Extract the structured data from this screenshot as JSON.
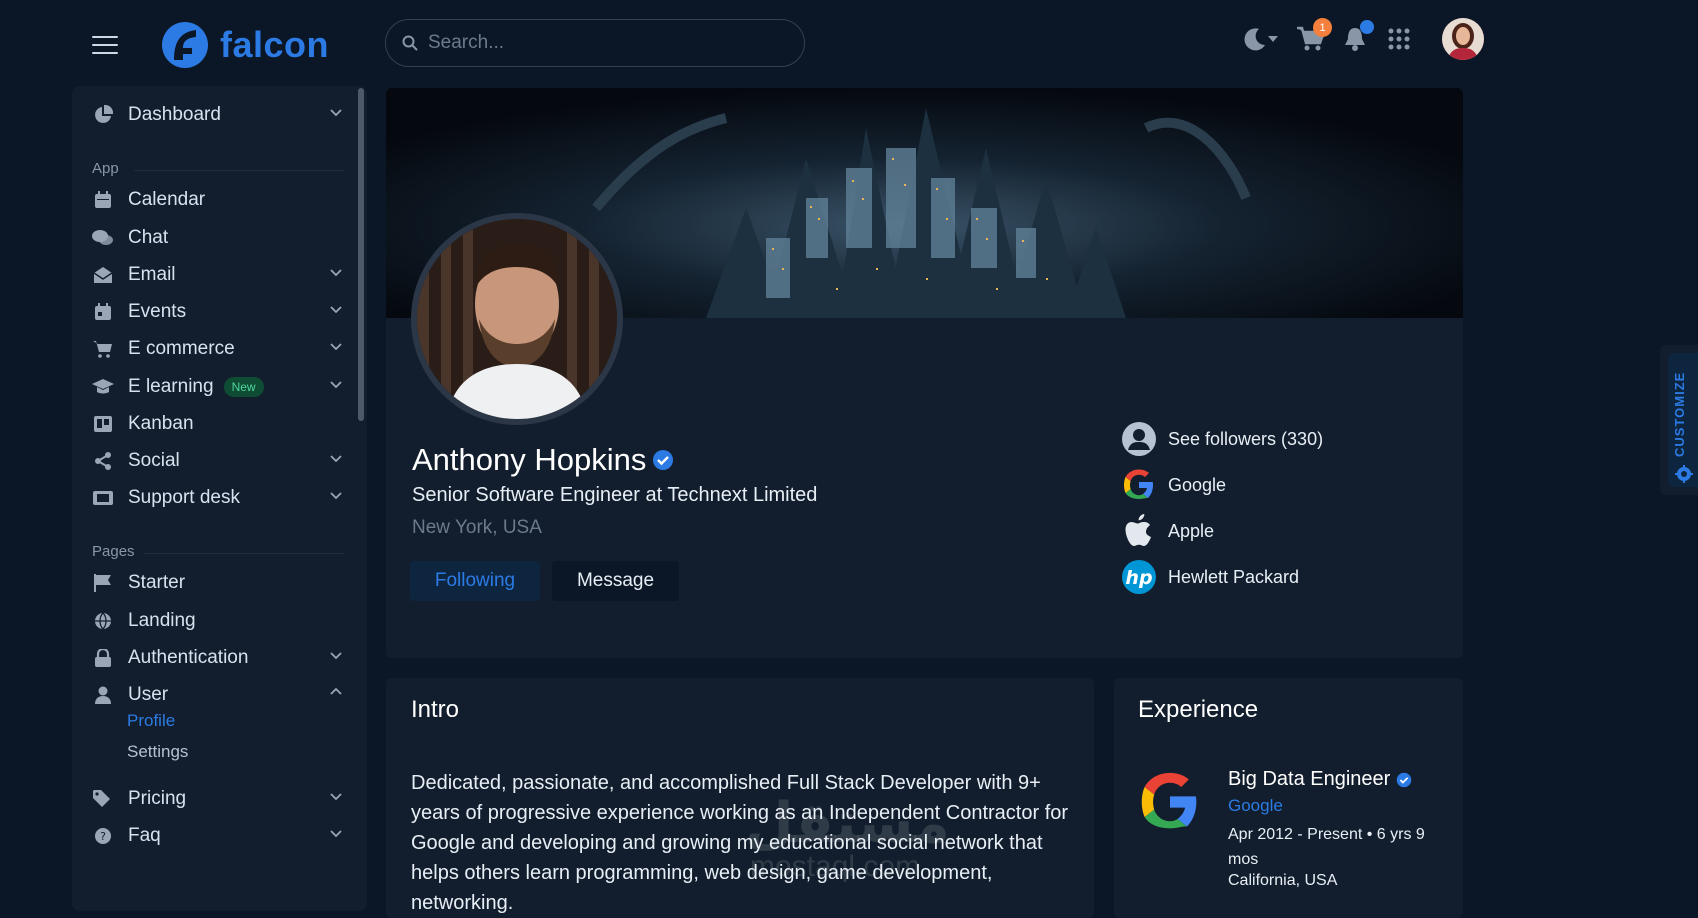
{
  "brand": {
    "name": "falcon",
    "color": "#2c7be5"
  },
  "search": {
    "placeholder": "Search..."
  },
  "topbar": {
    "cart_count": "1",
    "icons": [
      "moon-icon",
      "cart-icon",
      "bell-icon",
      "apps-grid-icon"
    ]
  },
  "sidebar": {
    "dashboard": "Dashboard",
    "app_section": "App",
    "pages_section": "Pages",
    "items": [
      {
        "label": "Calendar"
      },
      {
        "label": "Chat"
      },
      {
        "label": "Email"
      },
      {
        "label": "Events"
      },
      {
        "label": "E commerce"
      },
      {
        "label": "E learning",
        "badge": "New"
      },
      {
        "label": "Kanban"
      },
      {
        "label": "Social"
      },
      {
        "label": "Support desk"
      }
    ],
    "pages": [
      {
        "label": "Starter"
      },
      {
        "label": "Landing"
      },
      {
        "label": "Authentication"
      },
      {
        "label": "User"
      }
    ],
    "user_sub": [
      "Profile",
      "Settings"
    ],
    "more": [
      {
        "label": "Pricing"
      },
      {
        "label": "Faq"
      }
    ]
  },
  "profile": {
    "name": "Anthony Hopkins",
    "title": "Senior Software Engineer at Technext Limited",
    "location": "New York, USA",
    "follow_label": "Following",
    "message_label": "Message",
    "links": [
      {
        "label": "See followers (330)"
      },
      {
        "label": "Google"
      },
      {
        "label": "Apple"
      },
      {
        "label": "Hewlett Packard"
      }
    ]
  },
  "intro": {
    "heading": "Intro",
    "text": "Dedicated, passionate, and accomplished Full Stack Developer with 9+ years of progressive experience working as an Independent Contractor for Google and developing and growing my educational social network that helps others learn programming, web design, game development, networking."
  },
  "experience": {
    "heading": "Experience",
    "role": "Big Data Engineer",
    "company": "Google",
    "dates": "Apr 2012 - Present • 6 yrs 9 mos",
    "location": "California, USA"
  },
  "customize": {
    "label": "CUSTOMIZE"
  },
  "watermark": {
    "text": "مستقل",
    "sub": "mostaql.com"
  }
}
